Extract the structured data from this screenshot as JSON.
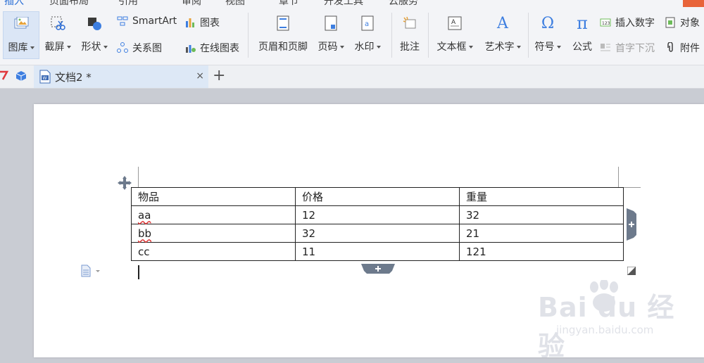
{
  "menu": {
    "tabs": [
      "插入",
      "页面布局",
      "引用",
      "审阅",
      "视图",
      "章节",
      "开发工具",
      "云服务"
    ],
    "active_index": 0,
    "accent_color": "#e8643a"
  },
  "ribbon": {
    "picture_lib": "图库",
    "screenshot": "截屏",
    "shapes": "形状",
    "smartart": "SmartArt",
    "relation_graph": "关系图",
    "chart": "图表",
    "online_chart": "在线图表",
    "header_footer": "页眉和页脚",
    "page_number": "页码",
    "watermark": "水印",
    "comment": "批注",
    "textbox": "文本框",
    "wordart": "艺术字",
    "symbol": "符号",
    "formula": "公式",
    "insert_number": "插入数字",
    "drop_cap": "首字下沉",
    "object": "对象",
    "attachment": "附件",
    "symbol_glyph": "Ω",
    "formula_glyph": "π",
    "wordart_glyph": "A"
  },
  "tabbar": {
    "doc_title": "文档2 *",
    "close_glyph": "×",
    "add_glyph": "+"
  },
  "table": {
    "headers": [
      "物品",
      "价格",
      "重量"
    ],
    "rows": [
      [
        "aa",
        "12",
        "32"
      ],
      [
        "bb",
        "32",
        "21"
      ],
      [
        "cc",
        "11",
        "121"
      ]
    ]
  },
  "watermark": {
    "main": "Bai du 经验",
    "sub": "jingyan.baidu.com"
  }
}
